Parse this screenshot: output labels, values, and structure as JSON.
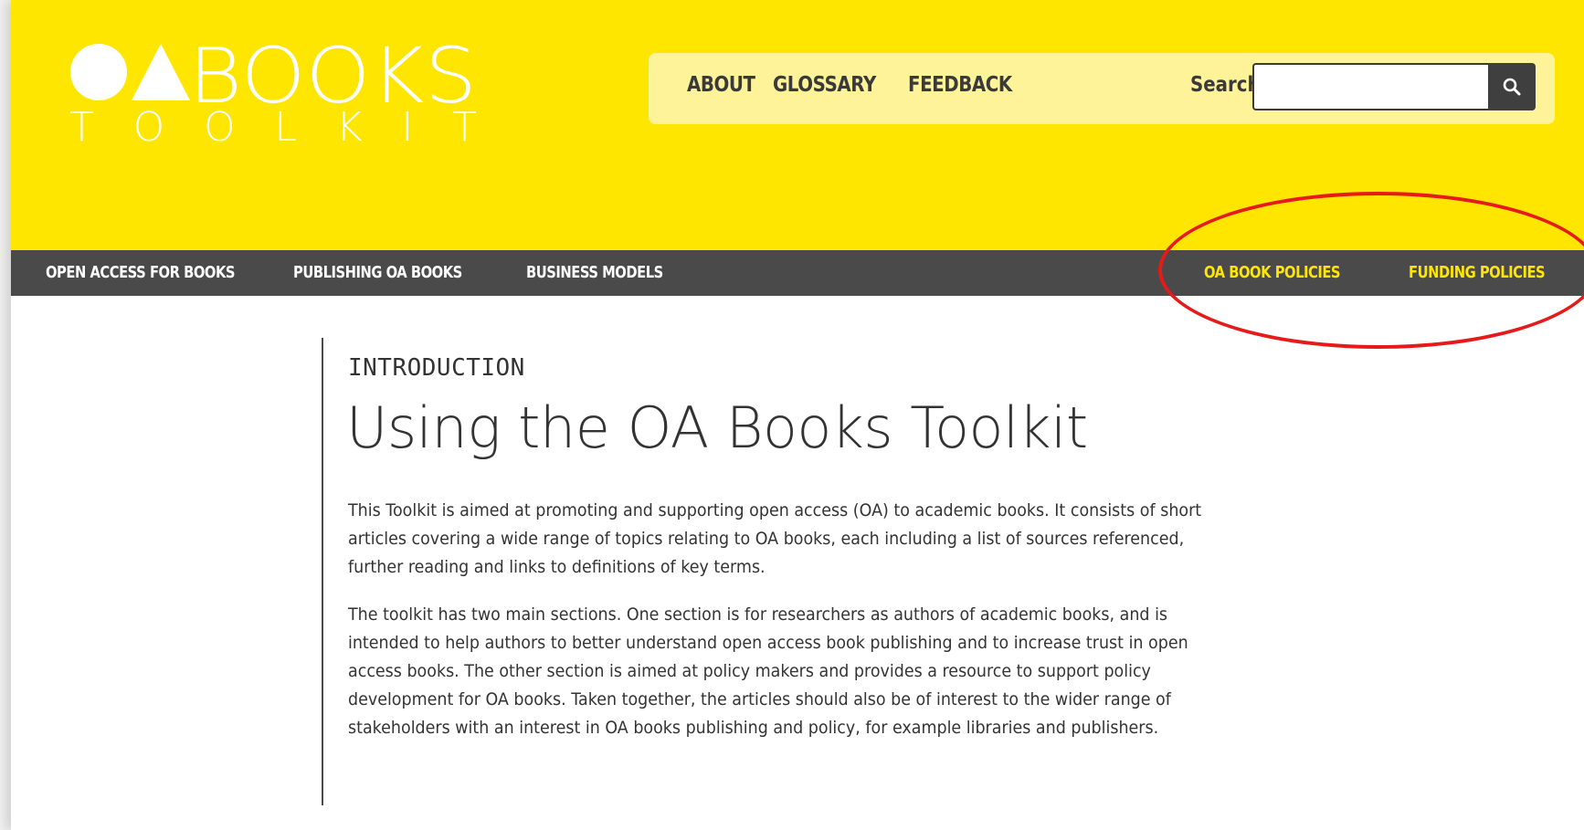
{
  "logo": {
    "text_top": "BOOKS",
    "text_bottom": "TOOLKIT"
  },
  "topnav": {
    "links": [
      "ABOUT",
      "GLOSSARY",
      "FEEDBACK"
    ],
    "search_label": "Search",
    "search_value": "",
    "search_icon": "magnifier-icon"
  },
  "mainnav": {
    "items": [
      "OPEN ACCESS FOR BOOKS",
      "PUBLISHING OA BOOKS",
      "BUSINESS MODELS",
      "OA BOOK POLICIES",
      "FUNDING POLICIES"
    ]
  },
  "content": {
    "kicker": "INTRODUCTION",
    "title": "Using the OA Books Toolkit",
    "paragraphs": [
      "This Toolkit is aimed at promoting and supporting open access (OA) to academic books. It consists of short articles covering a wide range of topics relating to OA books, each including a list of sources referenced, further reading and links to definitions of key terms.",
      "The toolkit has two main sections. One section is for researchers as authors of academic books, and is intended to help authors to better understand open access book publishing and to increase trust in open access books. The other section is aimed at policy makers and provides a resource to support policy development for OA books. Taken together, the articles should also be of interest to the wider range of stakeholders with an interest in OA books publishing and policy, for example libraries and publishers."
    ]
  },
  "colors": {
    "brand_yellow": "#ffe600",
    "nav_dark": "#4a4a4a",
    "annotation_red": "#e61a1a"
  }
}
